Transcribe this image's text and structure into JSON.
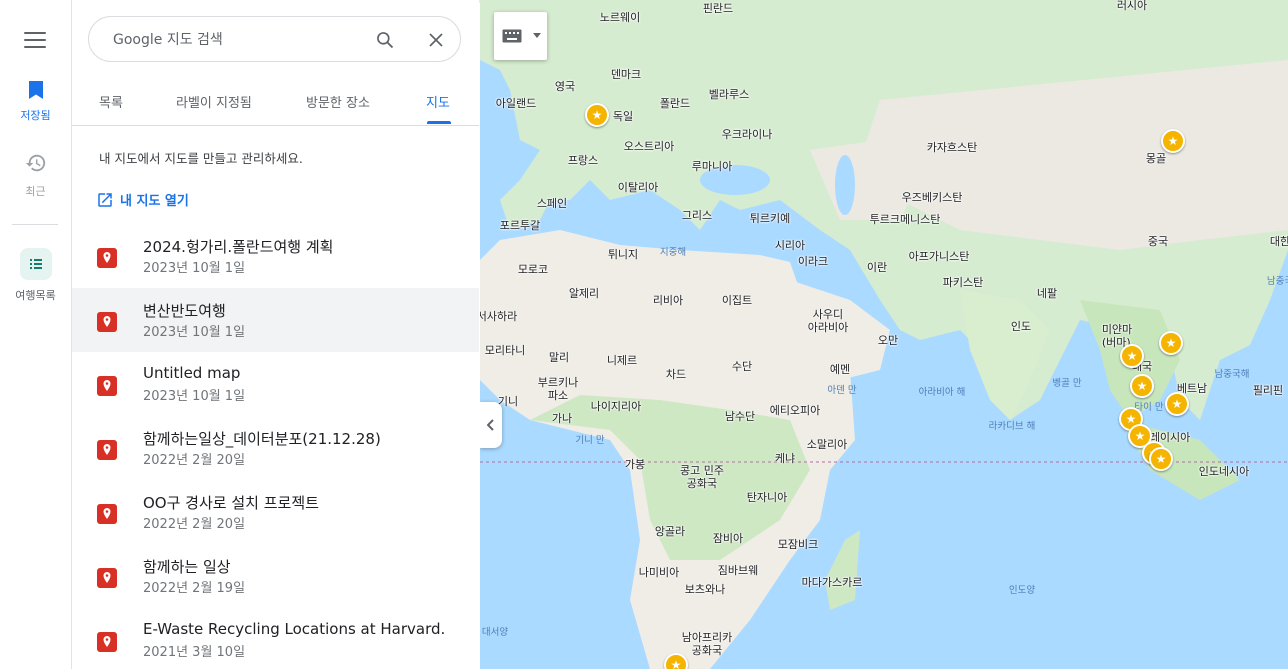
{
  "rail": {
    "saved_label": "저장됨",
    "recent_label": "최근",
    "trips_label": "여행목록"
  },
  "search": {
    "placeholder": "Google 지도 검색"
  },
  "tabs": [
    {
      "label": "목록"
    },
    {
      "label": "라벨이 지정됨"
    },
    {
      "label": "방문한 장소"
    },
    {
      "label": "지도"
    }
  ],
  "panel": {
    "intro": "내 지도에서 지도를 만들고 관리하세요.",
    "open_link": "내 지도 열기"
  },
  "maps": [
    {
      "title": "2024.헝가리.폴란드여행 계획",
      "date": "2023년 10월 1일"
    },
    {
      "title": "변산반도여행",
      "date": "2023년 10월 1일"
    },
    {
      "title": "Untitled map",
      "date": "2023년 10월 1일"
    },
    {
      "title": "함께하는일상_데이터분포(21.12.28)",
      "date": "2022년 2월 20일"
    },
    {
      "title": "OO구 경사로 설치 프로젝트",
      "date": "2022년 2월 20일"
    },
    {
      "title": "함께하는 일상",
      "date": "2022년 2월 19일"
    },
    {
      "title": "E-Waste Recycling Locations at Harvard.",
      "date": "2021년 3월 10일"
    }
  ],
  "map_labels": {
    "countries": [
      "핀란드",
      "노르웨이",
      "덴마크",
      "영국",
      "아일랜드",
      "독일",
      "폴란드",
      "벨라루스",
      "우크라이나",
      "프랑스",
      "오스트리아",
      "루마니아",
      "이탈리아",
      "스페인",
      "포르투갈",
      "그리스",
      "튀르키예",
      "카자흐스탄",
      "몽골",
      "우즈베키스탄",
      "투르크메니스탄",
      "중국",
      "시리아",
      "이라크",
      "이란",
      "아프가니스탄",
      "파키스탄",
      "네팔",
      "인도",
      "미얀마\n(버마)",
      "태국",
      "베트남",
      "필리핀",
      "말레이시아",
      "인도네시아",
      "튀니지",
      "모로코",
      "알제리",
      "리비아",
      "이집트",
      "사우디\n아라비아",
      "오만",
      "예멘",
      "서사하라",
      "모리타니",
      "말리",
      "니제르",
      "차드",
      "수단",
      "부르키나\n파소",
      "기니",
      "가나",
      "나이지리아",
      "남수단",
      "에티오피아",
      "소말리아",
      "케냐",
      "가봉",
      "콩고 민주\n공화국",
      "탄자니아",
      "앙골라",
      "잠비아",
      "모잠비크",
      "나미비아",
      "짐바브웨",
      "보츠와나",
      "마다가스카르",
      "남아프리카\n공화국",
      "러시아",
      "대한"
    ],
    "seas": [
      "지중해",
      "아덴 만",
      "아라비아 해",
      "벵골 만",
      "라카디브 해",
      "기니 만",
      "인도양",
      "남중국해",
      "대서양",
      "남중국",
      "타이 만"
    ]
  }
}
